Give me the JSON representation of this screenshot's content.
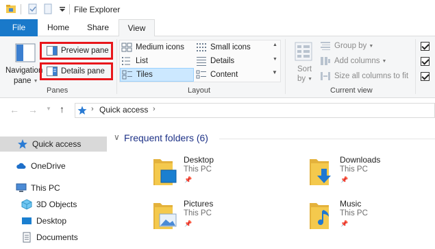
{
  "window": {
    "title": "File Explorer"
  },
  "tabs": [
    {
      "label": "File"
    },
    {
      "label": "Home"
    },
    {
      "label": "Share"
    },
    {
      "label": "View"
    }
  ],
  "ribbon": {
    "panes": {
      "navigation_pane_label_1": "Navigation",
      "navigation_pane_label_2": "pane",
      "preview_pane": "Preview pane",
      "details_pane": "Details pane",
      "group_label": "Panes"
    },
    "layout": {
      "medium_icons": "Medium icons",
      "small_icons": "Small icons",
      "list": "List",
      "details": "Details",
      "tiles": "Tiles",
      "content": "Content",
      "group_label": "Layout"
    },
    "current_view": {
      "sort_label_1": "Sort",
      "sort_label_2": "by",
      "group_by": "Group by",
      "add_columns": "Add columns",
      "size_all_columns": "Size all columns to fit",
      "group_label": "Current view"
    }
  },
  "address": {
    "path": "Quick access"
  },
  "nav": {
    "items": [
      {
        "label": "Quick access"
      },
      {
        "label": "OneDrive"
      },
      {
        "label": "This PC"
      },
      {
        "label": "3D Objects"
      },
      {
        "label": "Desktop"
      },
      {
        "label": "Documents"
      }
    ]
  },
  "content": {
    "section_title": "Frequent folders (6)",
    "folders": [
      {
        "name": "Desktop",
        "location": "This PC"
      },
      {
        "name": "Downloads",
        "location": "This PC"
      },
      {
        "name": "Pictures",
        "location": "This PC"
      },
      {
        "name": "Music",
        "location": "This PC"
      }
    ]
  },
  "colors": {
    "accent": "#1979ca",
    "highlight_border": "#e8161b",
    "selected_bg": "#cce8ff",
    "folder_yellow": "#f4c94d"
  }
}
